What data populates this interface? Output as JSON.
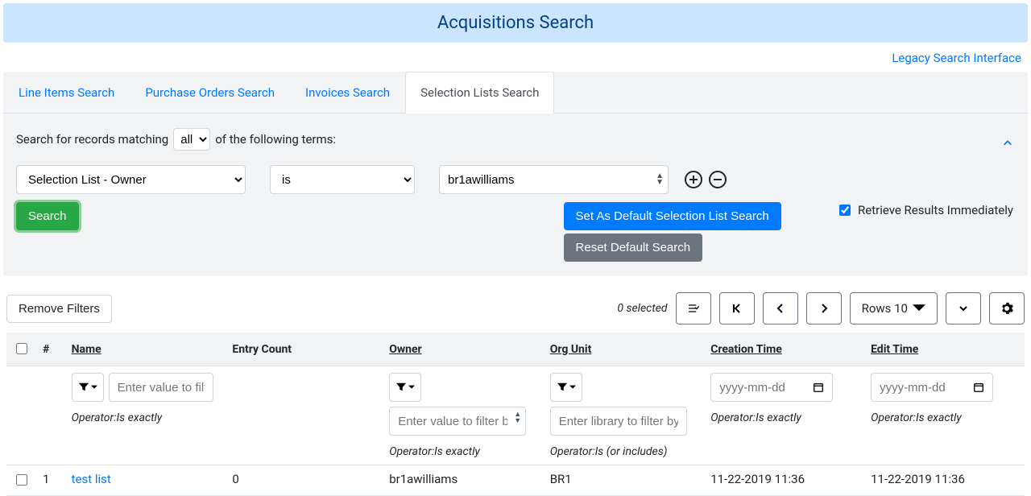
{
  "header": {
    "title": "Acquisitions Search",
    "legacy_link": "Legacy Search Interface"
  },
  "tabs": [
    {
      "label": "Line Items Search",
      "active": false
    },
    {
      "label": "Purchase Orders Search",
      "active": false
    },
    {
      "label": "Invoices Search",
      "active": false
    },
    {
      "label": "Selection Lists Search",
      "active": true
    }
  ],
  "search": {
    "prefix": "Search for records matching",
    "match_mode": "all",
    "suffix": "of the following terms:",
    "field": "Selection List - Owner",
    "operator": "is",
    "value": "br1awilliams",
    "search_btn": "Search",
    "set_default_btn": "Set As Default Selection List Search",
    "reset_default_btn": "Reset Default Search",
    "retrieve_label": "Retrieve Results Immediately",
    "retrieve_checked": true
  },
  "toolbar": {
    "remove_filters": "Remove Filters",
    "selected_count": "0 selected",
    "rows_label": "Rows 10"
  },
  "columns": {
    "num": "#",
    "name": "Name",
    "entry_count": "Entry Count",
    "owner": "Owner",
    "org_unit": "Org Unit",
    "creation_time": "Creation Time",
    "edit_time": "Edit Time"
  },
  "filters": {
    "name_placeholder": "Enter value to filter",
    "owner_placeholder": "Enter value to filter by",
    "org_placeholder": "Enter library to filter by",
    "date_placeholder": "yyyy-mm-dd",
    "op_exact": "Operator:Is exactly",
    "op_includes": "Operator:Is (or includes)"
  },
  "rows": [
    {
      "num": "1",
      "name": "test list",
      "entry_count": "0",
      "owner": "br1awilliams",
      "org_unit": "BR1",
      "creation_time": "11-22-2019 11:36",
      "edit_time": "11-22-2019 11:36"
    }
  ]
}
